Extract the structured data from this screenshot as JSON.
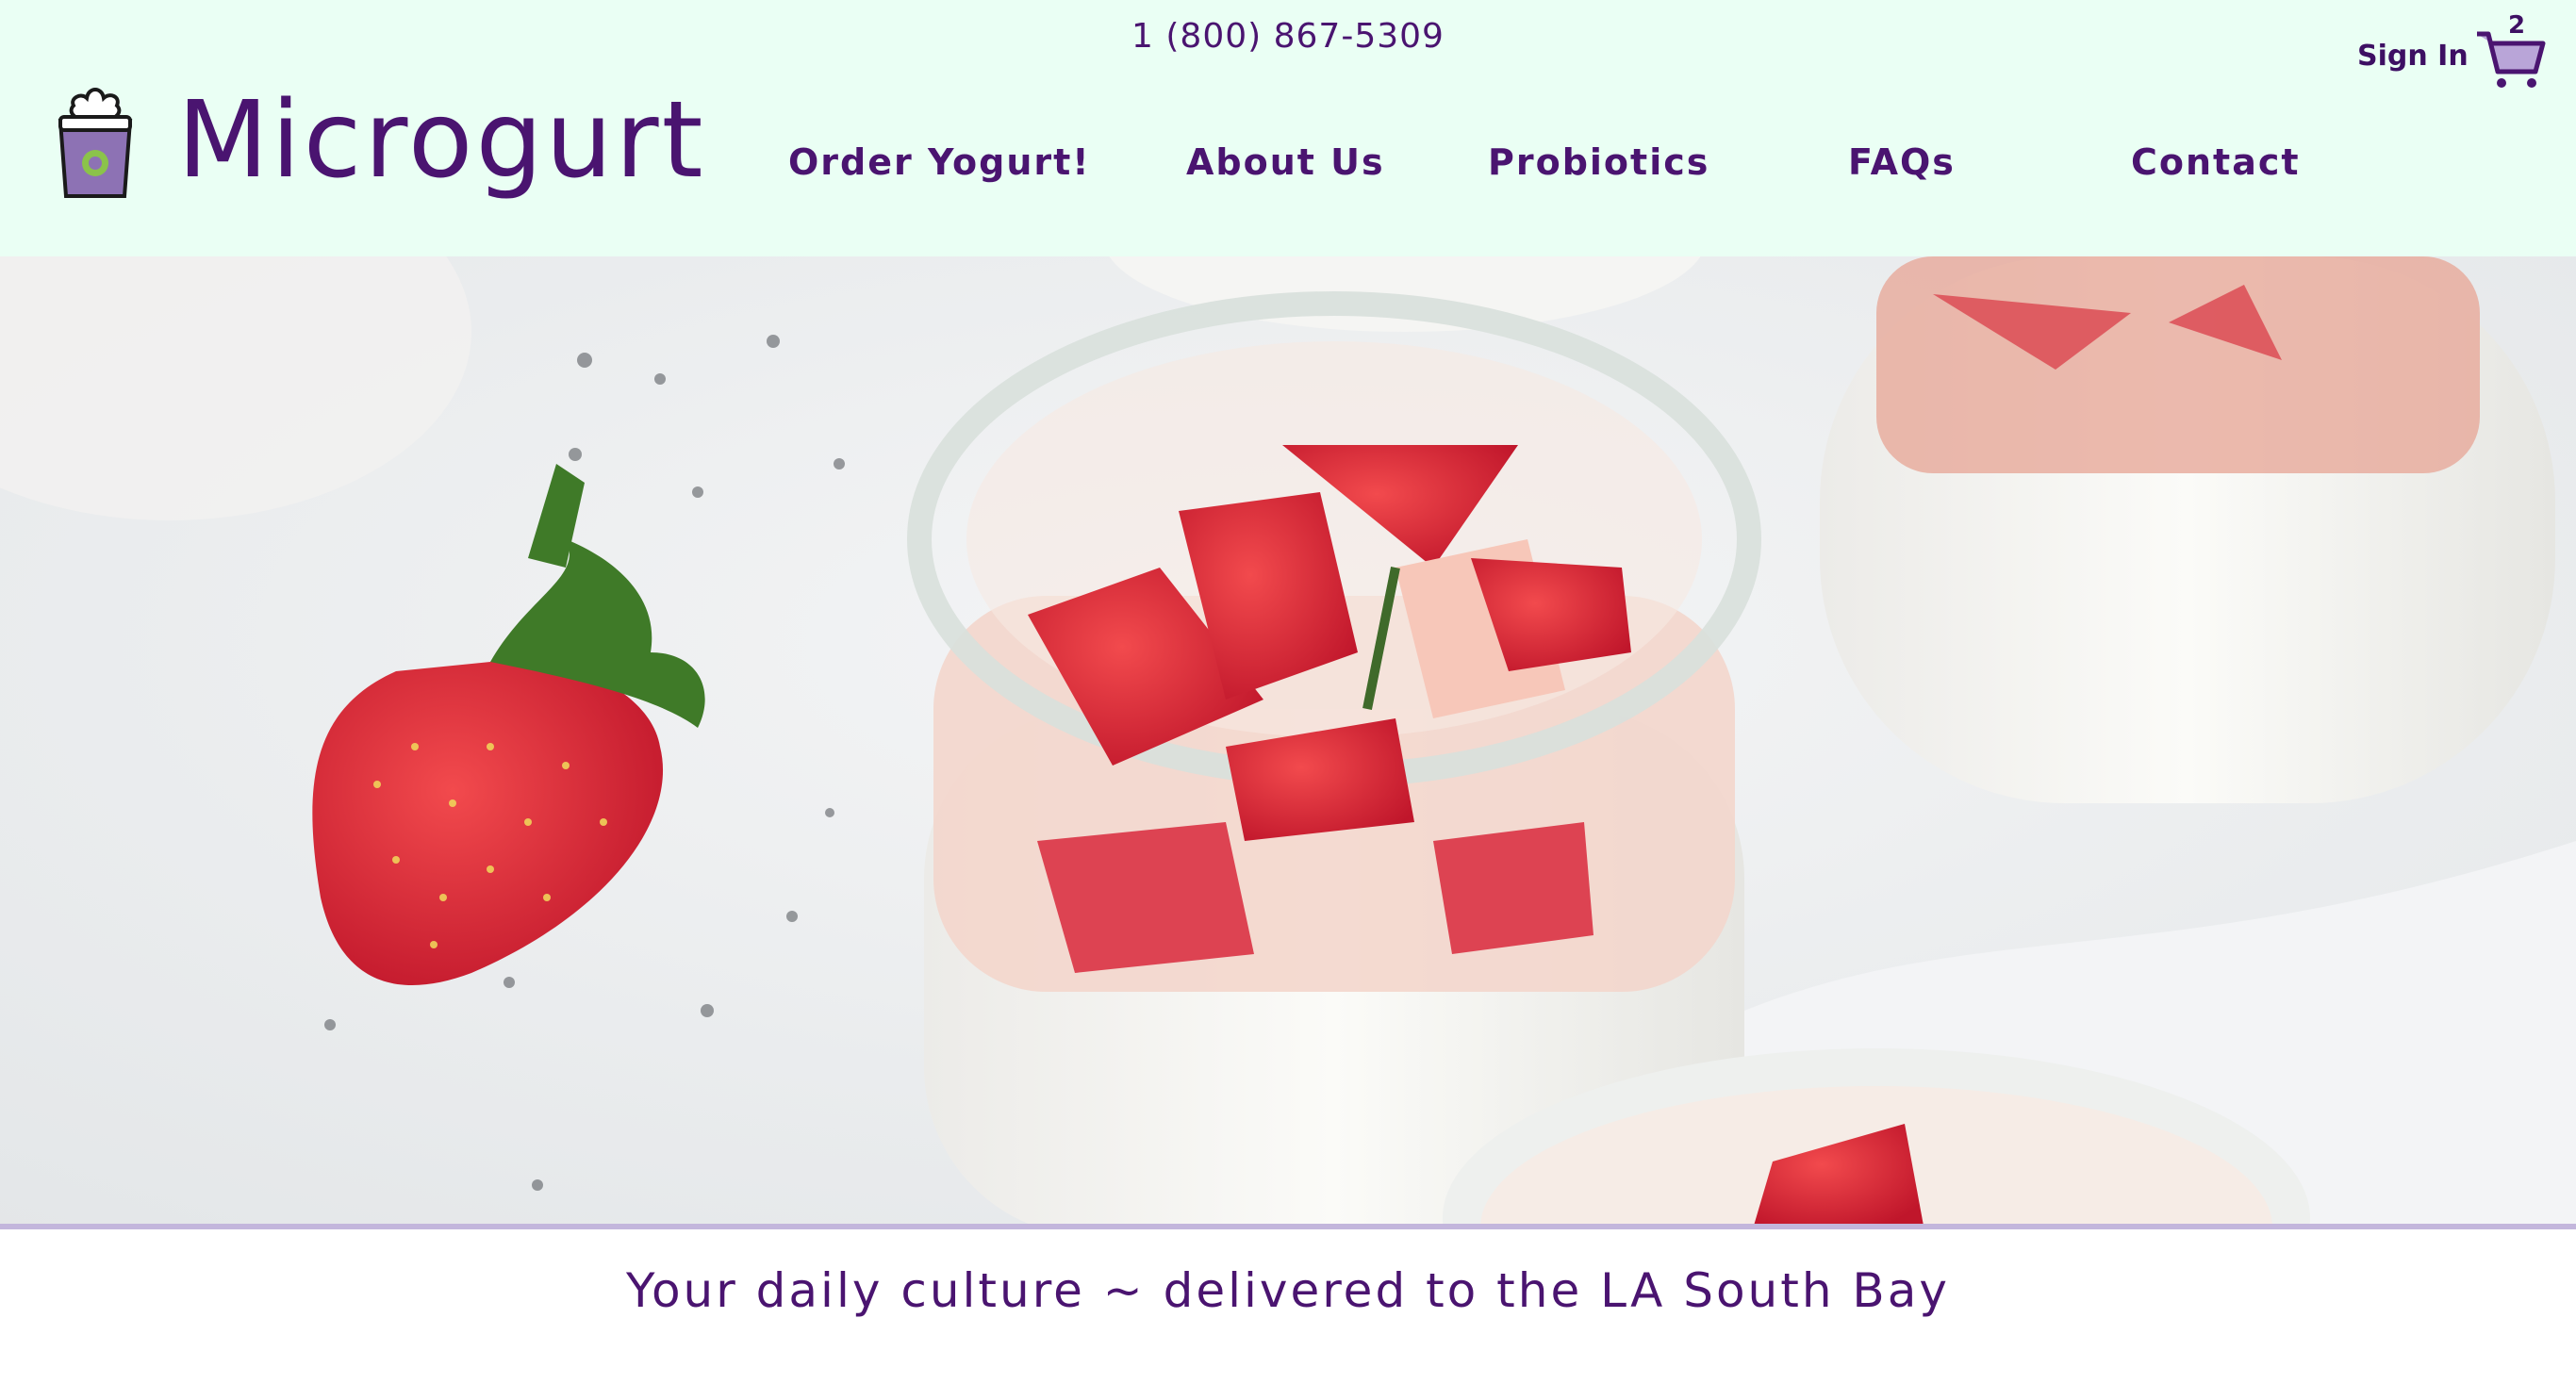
{
  "header": {
    "phone": "1 (800) 867-5309",
    "sign_in_label": "Sign In",
    "cart_count": "2",
    "brand": "Microgurt"
  },
  "nav": {
    "items": [
      {
        "label": "Order Yogurt!"
      },
      {
        "label": "About Us"
      },
      {
        "label": "Probiotics"
      },
      {
        "label": "FAQs"
      },
      {
        "label": "Contact"
      }
    ]
  },
  "hero": {
    "image": "yogurt jars with strawberries"
  },
  "tagline": "Your daily culture ~ delivered to the LA South Bay",
  "colors": {
    "header_bg": "#eafff4",
    "brand_purple": "#4a1470",
    "divider": "#c3b6dc"
  },
  "icons": [
    "yogurt-cup-logo-icon",
    "shopping-cart-icon"
  ]
}
